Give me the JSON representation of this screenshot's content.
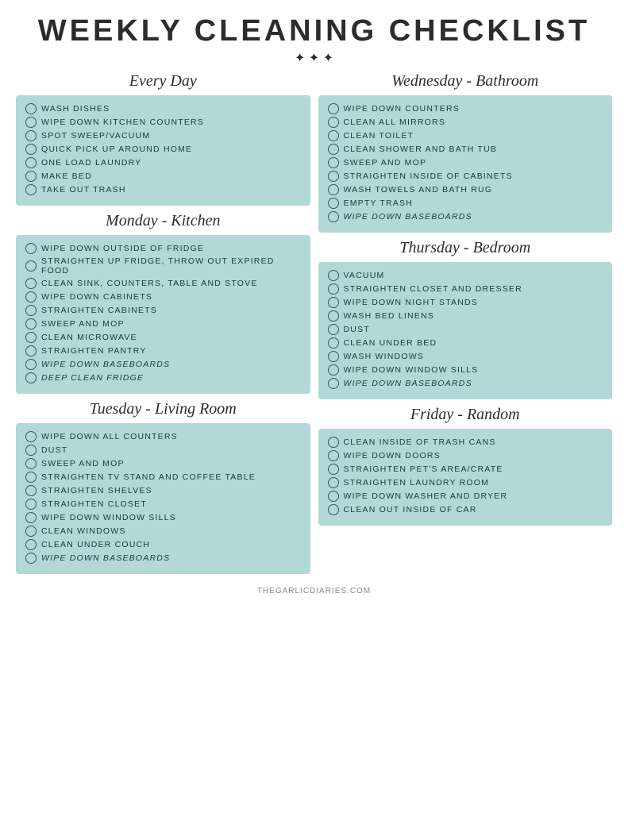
{
  "page": {
    "title": "WEEKLY CLEANING CHECKLIST",
    "footer": "THEGARLICDIARIES.COM"
  },
  "sections": {
    "every_day": {
      "title": "Every Day",
      "items": [
        {
          "text": "WASH DISHES",
          "italic": false
        },
        {
          "text": "WIPE DOWN KITCHEN COUNTERS",
          "italic": false
        },
        {
          "text": "SPOT SWEEP/VACUUM",
          "italic": false
        },
        {
          "text": "QUICK PICK UP AROUND HOME",
          "italic": false
        },
        {
          "text": "ONE LOAD LAUNDRY",
          "italic": false
        },
        {
          "text": "MAKE BED",
          "italic": false
        },
        {
          "text": "TAKE OUT TRASH",
          "italic": false
        }
      ]
    },
    "wednesday_bathroom": {
      "title": "Wednesday - Bathroom",
      "items": [
        {
          "text": "WIPE DOWN COUNTERS",
          "italic": false
        },
        {
          "text": "CLEAN ALL MIRRORS",
          "italic": false
        },
        {
          "text": "CLEAN TOILET",
          "italic": false
        },
        {
          "text": "CLEAN SHOWER AND BATH TUB",
          "italic": false
        },
        {
          "text": "SWEEP AND MOP",
          "italic": false
        },
        {
          "text": "STRAIGHTEN INSIDE OF CABINETS",
          "italic": false
        },
        {
          "text": "WASH TOWELS AND BATH RUG",
          "italic": false
        },
        {
          "text": "EMPTY TRASH",
          "italic": false
        },
        {
          "text": "WIPE DOWN BASEBOARDS",
          "italic": true
        }
      ]
    },
    "monday_kitchen": {
      "title": "Monday - Kitchen",
      "items": [
        {
          "text": "WIPE DOWN OUTSIDE OF FRIDGE",
          "italic": false
        },
        {
          "text": "STRAIGHTEN UP FRIDGE, THROW OUT EXPIRED FOOD",
          "italic": false
        },
        {
          "text": "CLEAN SINK, COUNTERS, TABLE AND STOVE",
          "italic": false
        },
        {
          "text": "WIPE DOWN CABINETS",
          "italic": false
        },
        {
          "text": "STRAIGHTEN CABINETS",
          "italic": false
        },
        {
          "text": "SWEEP AND MOP",
          "italic": false
        },
        {
          "text": "CLEAN MICROWAVE",
          "italic": false
        },
        {
          "text": "STRAIGHTEN PANTRY",
          "italic": false
        },
        {
          "text": "WIPE DOWN BASEBOARDS",
          "italic": true
        },
        {
          "text": "DEEP CLEAN FRIDGE",
          "italic": true
        }
      ]
    },
    "thursday_bedroom": {
      "title": "Thursday - Bedroom",
      "items": [
        {
          "text": "VACUUM",
          "italic": false
        },
        {
          "text": "STRAIGHTEN CLOSET AND DRESSER",
          "italic": false
        },
        {
          "text": "WIPE DOWN NIGHT STANDS",
          "italic": false
        },
        {
          "text": "WASH BED LINENS",
          "italic": false
        },
        {
          "text": "DUST",
          "italic": false
        },
        {
          "text": "CLEAN UNDER BED",
          "italic": false
        },
        {
          "text": "WASH WINDOWS",
          "italic": false
        },
        {
          "text": "WIPE DOWN WINDOW SILLS",
          "italic": false
        },
        {
          "text": "WIPE DOWN BASEBOARDS",
          "italic": true
        }
      ]
    },
    "tuesday_living_room": {
      "title": "Tuesday - Living Room",
      "items": [
        {
          "text": "WIPE DOWN ALL COUNTERS",
          "italic": false
        },
        {
          "text": "DUST",
          "italic": false
        },
        {
          "text": "SWEEP AND MOP",
          "italic": false
        },
        {
          "text": "STRAIGHTEN TV STAND AND COFFEE TABLE",
          "italic": false
        },
        {
          "text": "STRAIGHTEN SHELVES",
          "italic": false
        },
        {
          "text": "STRAIGHTEN CLOSET",
          "italic": false
        },
        {
          "text": "WIPE DOWN WINDOW SILLS",
          "italic": false
        },
        {
          "text": "CLEAN WINDOWS",
          "italic": false
        },
        {
          "text": "CLEAN UNDER COUCH",
          "italic": false
        },
        {
          "text": "WIPE DOWN BASEBOARDS",
          "italic": true
        }
      ]
    },
    "friday_random": {
      "title": "Friday - Random",
      "items": [
        {
          "text": "CLEAN INSIDE OF TRASH CANS",
          "italic": false
        },
        {
          "text": "WIPE DOWN DOORS",
          "italic": false
        },
        {
          "text": "STRAIGHTEN PET'S AREA/CRATE",
          "italic": false
        },
        {
          "text": "STRAIGHTEN LAUNDRY ROOM",
          "italic": false
        },
        {
          "text": "WIPE DOWN WASHER AND DRYER",
          "italic": false
        },
        {
          "text": "CLEAN OUT INSIDE OF CAR",
          "italic": false
        }
      ]
    }
  }
}
